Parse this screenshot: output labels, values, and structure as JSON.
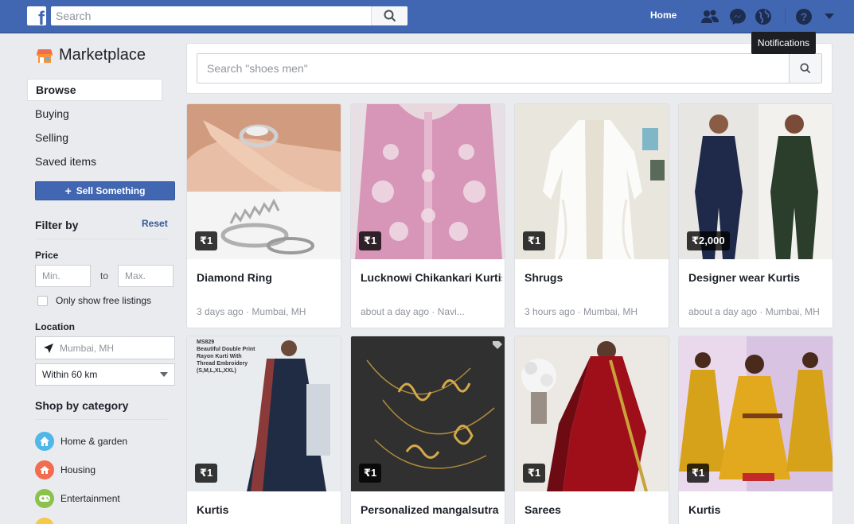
{
  "topbar": {
    "search_placeholder": "Search",
    "home_label": "Home",
    "tooltip": "Notifications"
  },
  "sidebar": {
    "title": "Marketplace",
    "nav": [
      {
        "label": "Browse",
        "active": true
      },
      {
        "label": "Buying",
        "active": false
      },
      {
        "label": "Selling",
        "active": false
      },
      {
        "label": "Saved items",
        "active": false
      }
    ],
    "sell_label": "Sell Something",
    "filter_by": "Filter by",
    "reset": "Reset",
    "price_label": "Price",
    "min_placeholder": "Min.",
    "to": "to",
    "max_placeholder": "Max.",
    "free_only": "Only show free listings",
    "location_label": "Location",
    "location_placeholder": "Mumbai, MH",
    "radius": "Within 60 km",
    "shop_by_category": "Shop by category",
    "categories": [
      {
        "label": "Home & garden",
        "color": "#4fb8e8"
      },
      {
        "label": "Housing",
        "color": "#f26c4f"
      },
      {
        "label": "Entertainment",
        "color": "#8bc34a"
      }
    ]
  },
  "main": {
    "search_placeholder": "Search \"shoes men\"",
    "listings": [
      {
        "price": "₹1",
        "title": "Diamond Ring",
        "meta": "3 days ago · Mumbai, MH"
      },
      {
        "price": "₹1",
        "title": "Lucknowi Chikankari Kurtis",
        "meta": "about a day ago · Navi..."
      },
      {
        "price": "₹1",
        "title": "Shrugs",
        "meta": "3 hours ago · Mumbai, MH"
      },
      {
        "price": "₹2,000",
        "title": "Designer wear Kurtis",
        "meta": "about a day ago · Mumbai, MH"
      },
      {
        "price": "₹1",
        "title": "Kurtis",
        "meta": ""
      },
      {
        "price": "₹1",
        "title": "Personalized mangalsutra",
        "meta": ""
      },
      {
        "price": "₹1",
        "title": "Sarees",
        "meta": ""
      },
      {
        "price": "₹1",
        "title": "Kurtis",
        "meta": ""
      }
    ],
    "listing5_caption": {
      "code": "MS829",
      "line1": "Beautiful Double Print",
      "line2": "Rayon Kurti With",
      "line3": "Thread Embroidery",
      "line4": "(S,M,L,XL,XXL)"
    }
  },
  "colors": {
    "brand": "#4267b2",
    "background": "#e9ebee",
    "link": "#365899"
  }
}
